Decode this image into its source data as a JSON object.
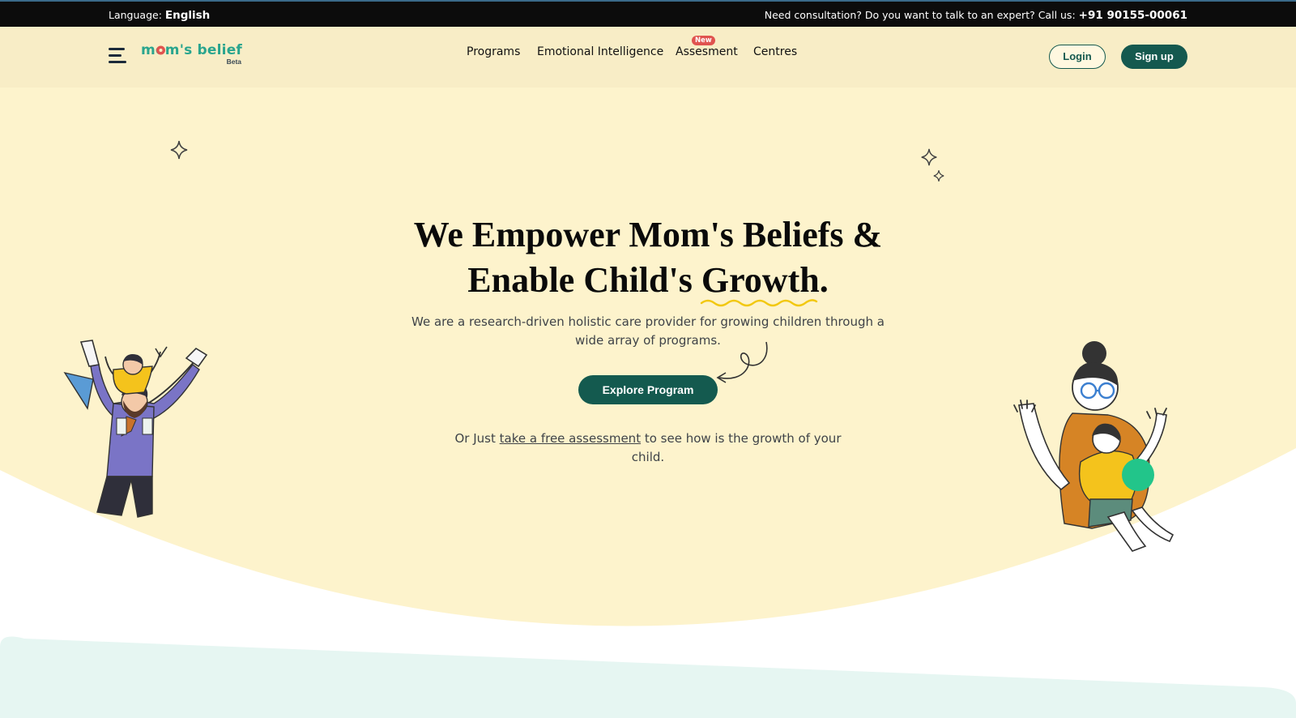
{
  "topbar": {
    "language_label": "Language:",
    "language_value": "English",
    "consult_text": "Need consultation? Do you want to talk to an expert? Call us:",
    "phone": "+91 90155-00061"
  },
  "header": {
    "logo_text": "mom's belief",
    "logo_badge": "Beta",
    "nav": [
      {
        "label": "Programs"
      },
      {
        "label": "Emotional Intelligence"
      },
      {
        "label": "Assesment",
        "badge": "New"
      },
      {
        "label": "Centres"
      }
    ],
    "login_label": "Login",
    "signup_label": "Sign up"
  },
  "hero": {
    "title_line1": "We Empower Mom's Beliefs &",
    "title_line2_prefix": "Enable Child's ",
    "title_highlight": "Growth",
    "title_suffix": ".",
    "subtitle": "We are a research-driven holistic care provider for growing children through a wide array of programs.",
    "cta_label": "Explore Program",
    "assess_prefix": "Or Just ",
    "assess_link": "take a free assessment",
    "assess_suffix": " to see how is the growth of your child."
  },
  "colors": {
    "topbar_bg": "#0c0c0c",
    "header_bg": "#f8edc6",
    "hero_bg": "#fdf3cc",
    "brand_green": "#145a4f",
    "logo_teal": "#2aa58e",
    "badge_red": "#e0534f",
    "underline_yellow": "#f2c811",
    "next_section_bg": "#e6f6f2"
  }
}
